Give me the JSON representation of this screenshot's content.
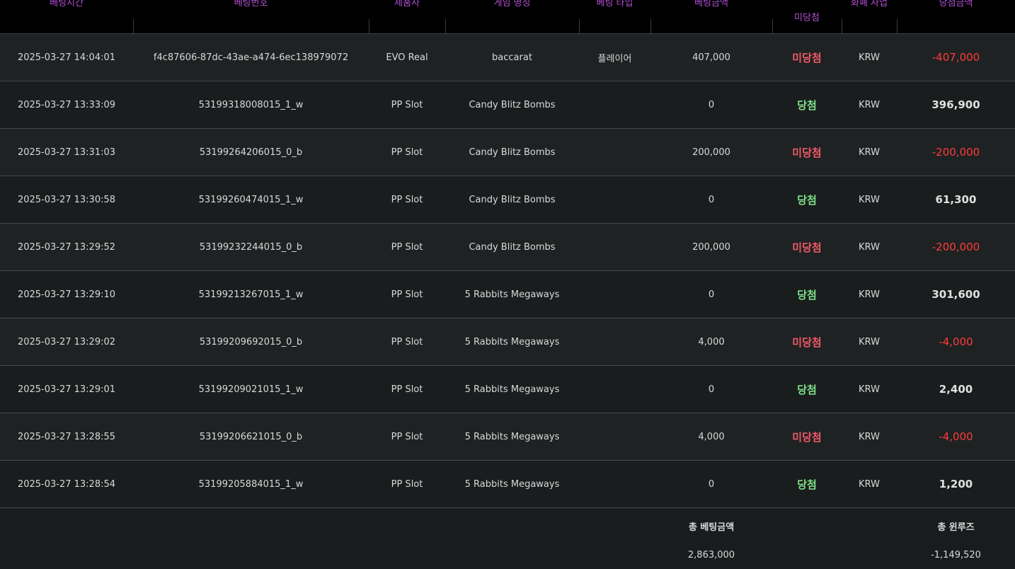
{
  "header": {
    "columns": [
      {
        "label": "베팅시간"
      },
      {
        "label": "베팅번호"
      },
      {
        "label": "제품사"
      },
      {
        "label": "게임 명칭"
      },
      {
        "label": "베팅 타입"
      },
      {
        "label": "베팅금액"
      },
      {
        "label": "미당첨"
      },
      {
        "label": "화폐 사업"
      },
      {
        "label": "당첨금액"
      }
    ]
  },
  "rows": [
    {
      "time": "2025-03-27 14:04:01",
      "bet_id": "f4c87606-87dc-43ae-a474-6ec138979072",
      "provider": "EVO Real",
      "game": "baccarat",
      "bet_type": "플레이어",
      "bet_amount": "407,000",
      "result": "미당첨",
      "result_kind": "lose",
      "currency": "KRW",
      "win_amount": "-407,000"
    },
    {
      "time": "2025-03-27 13:33:09",
      "bet_id": "53199318008015_1_w",
      "provider": "PP Slot",
      "game": "Candy Blitz Bombs",
      "bet_type": "",
      "bet_amount": "0",
      "result": "당첨",
      "result_kind": "win",
      "currency": "KRW",
      "win_amount": "396,900"
    },
    {
      "time": "2025-03-27 13:31:03",
      "bet_id": "53199264206015_0_b",
      "provider": "PP Slot",
      "game": "Candy Blitz Bombs",
      "bet_type": "",
      "bet_amount": "200,000",
      "result": "미당첨",
      "result_kind": "lose",
      "currency": "KRW",
      "win_amount": "-200,000"
    },
    {
      "time": "2025-03-27 13:30:58",
      "bet_id": "53199260474015_1_w",
      "provider": "PP Slot",
      "game": "Candy Blitz Bombs",
      "bet_type": "",
      "bet_amount": "0",
      "result": "당첨",
      "result_kind": "win",
      "currency": "KRW",
      "win_amount": "61,300"
    },
    {
      "time": "2025-03-27 13:29:52",
      "bet_id": "53199232244015_0_b",
      "provider": "PP Slot",
      "game": "Candy Blitz Bombs",
      "bet_type": "",
      "bet_amount": "200,000",
      "result": "미당첨",
      "result_kind": "lose",
      "currency": "KRW",
      "win_amount": "-200,000"
    },
    {
      "time": "2025-03-27 13:29:10",
      "bet_id": "53199213267015_1_w",
      "provider": "PP Slot",
      "game": "5 Rabbits Megaways",
      "bet_type": "",
      "bet_amount": "0",
      "result": "당첨",
      "result_kind": "win",
      "currency": "KRW",
      "win_amount": "301,600"
    },
    {
      "time": "2025-03-27 13:29:02",
      "bet_id": "53199209692015_0_b",
      "provider": "PP Slot",
      "game": "5 Rabbits Megaways",
      "bet_type": "",
      "bet_amount": "4,000",
      "result": "미당첨",
      "result_kind": "lose",
      "currency": "KRW",
      "win_amount": "-4,000"
    },
    {
      "time": "2025-03-27 13:29:01",
      "bet_id": "53199209021015_1_w",
      "provider": "PP Slot",
      "game": "5 Rabbits Megaways",
      "bet_type": "",
      "bet_amount": "0",
      "result": "당첨",
      "result_kind": "win",
      "currency": "KRW",
      "win_amount": "2,400"
    },
    {
      "time": "2025-03-27 13:28:55",
      "bet_id": "53199206621015_0_b",
      "provider": "PP Slot",
      "game": "5 Rabbits Megaways",
      "bet_type": "",
      "bet_amount": "4,000",
      "result": "미당첨",
      "result_kind": "lose",
      "currency": "KRW",
      "win_amount": "-4,000"
    },
    {
      "time": "2025-03-27 13:28:54",
      "bet_id": "53199205884015_1_w",
      "provider": "PP Slot",
      "game": "5 Rabbits Megaways",
      "bet_type": "",
      "bet_amount": "0",
      "result": "당첨",
      "result_kind": "win",
      "currency": "KRW",
      "win_amount": "1,200"
    }
  ],
  "summary": {
    "total_bet_label": "총 베팅금액",
    "total_bet_value": "2,863,000",
    "total_winloss_label": "총 윈루즈",
    "total_winloss_value": "-1,149,520"
  },
  "colors": {
    "header_text": "#b44fd6",
    "win": "#7fe08a",
    "lose": "#f05a6a",
    "negative_amount": "#ff3b3b"
  }
}
